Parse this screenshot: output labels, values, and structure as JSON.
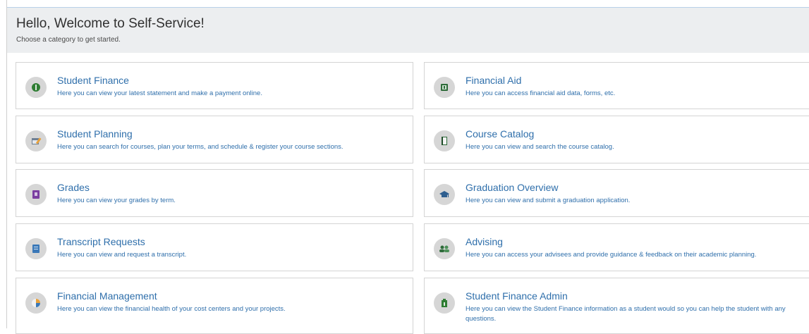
{
  "header": {
    "title": "Hello, Welcome to Self-Service!",
    "subtitle": "Choose a category to get started."
  },
  "cards": [
    {
      "title": "Student Finance",
      "desc": "Here you can view your latest statement and make a payment online.",
      "icon": "dollar-coin-icon"
    },
    {
      "title": "Financial Aid",
      "desc": "Here you can access financial aid data, forms, etc.",
      "icon": "money-icon"
    },
    {
      "title": "Student Planning",
      "desc": "Here you can search for courses, plan your terms, and schedule & register your course sections.",
      "icon": "calendar-icon"
    },
    {
      "title": "Course Catalog",
      "desc": "Here you can view and search the course catalog.",
      "icon": "book-icon"
    },
    {
      "title": "Grades",
      "desc": "Here you can view your grades by term.",
      "icon": "grade-report-icon"
    },
    {
      "title": "Graduation Overview",
      "desc": "Here you can view and submit a graduation application.",
      "icon": "graduation-cap-icon"
    },
    {
      "title": "Transcript Requests",
      "desc": "Here you can view and request a transcript.",
      "icon": "transcript-icon"
    },
    {
      "title": "Advising",
      "desc": "Here you can access your advisees and provide guidance & feedback on their academic planning.",
      "icon": "people-icon"
    },
    {
      "title": "Financial Management",
      "desc": "Here you can view the financial health of your cost centers and your projects.",
      "icon": "pie-chart-icon"
    },
    {
      "title": "Student Finance Admin",
      "desc": "Here you can view the Student Finance information as a student would so you can help the student with any questions.",
      "icon": "admin-finance-icon"
    }
  ],
  "colors": {
    "link": "#2f6fab",
    "header_bg": "#eceef0",
    "icon_bg": "#d6d6d6"
  }
}
